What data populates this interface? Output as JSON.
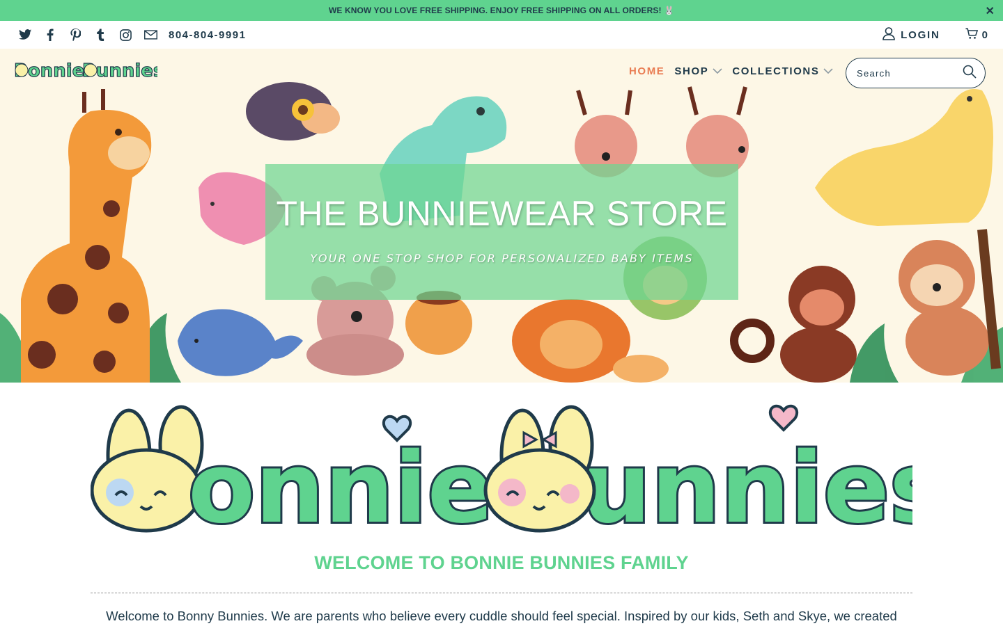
{
  "announcement": {
    "text": "WE KNOW YOU LOVE FREE SHIPPING. ENJOY FREE SHIPPING ON ALL ORDERS! 🐰",
    "close_icon": "close-icon"
  },
  "topbar": {
    "social_icons": [
      "twitter-icon",
      "facebook-icon",
      "pinterest-icon",
      "tumblr-icon",
      "instagram-icon",
      "email-icon"
    ],
    "phone": "804-804-9991",
    "login_label": "LOGIN",
    "cart_count": "0"
  },
  "header": {
    "logo_text": "Bonnie Bunnies",
    "nav": [
      {
        "label": "HOME",
        "active": true
      },
      {
        "label": "SHOP",
        "dropdown": true
      },
      {
        "label": "COLLECTIONS",
        "dropdown": true
      }
    ],
    "search": {
      "placeholder": "Search",
      "value": ""
    }
  },
  "hero": {
    "title": "THE BUNNIEWEAR STORE",
    "subtitle": "YOUR ONE STOP SHOP FOR PERSONALIZED BABY ITEMS"
  },
  "welcome": {
    "title": "WELCOME TO BONNIE BUNNIES FAMILY",
    "text": "Welcome to Bonny Bunnies. We are parents who believe every cuddle should feel special. Inspired by our kids, Seth and Skye, we created"
  },
  "colors": {
    "accent_green": "#5fd38f",
    "navy": "#1f3a4a",
    "nav_active": "#e97c52",
    "hero_bg": "#fdf7e6"
  }
}
